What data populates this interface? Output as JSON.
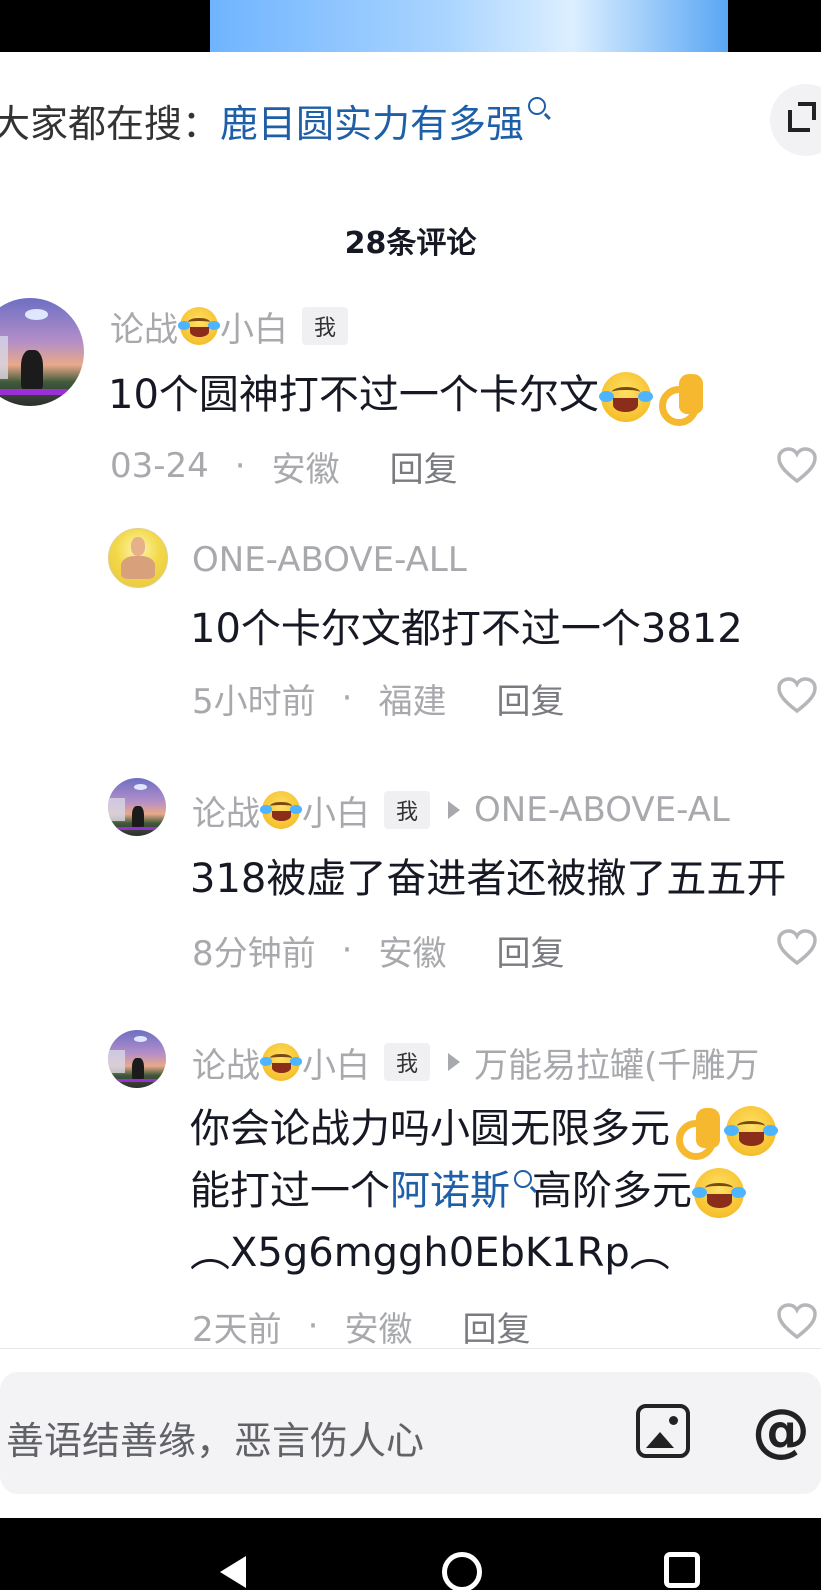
{
  "search": {
    "prefix": "大家都在搜：",
    "term": "鹿目圆实力有多强"
  },
  "header": {
    "comment_count": "28条评论"
  },
  "comments": [
    {
      "username": "论战",
      "username_suffix": "小白",
      "badge": "我",
      "text": "10个圆神打不过一个卡尔文",
      "date": "03-24",
      "location": "安徽",
      "reply_label": "回复"
    },
    {
      "username": "ONE-ABOVE-ALL",
      "text": "10个卡尔文都打不过一个3812",
      "date": "5小时前",
      "location": "福建",
      "reply_label": "回复"
    },
    {
      "username": "论战",
      "username_suffix": "小白",
      "badge": "我",
      "reply_to": "ONE-ABOVE-AL",
      "text": "318被虚了奋进者还被撤了五五开",
      "date": "8分钟前",
      "location": "安徽",
      "reply_label": "回复"
    },
    {
      "username": "论战",
      "username_suffix": "小白",
      "badge": "我",
      "reply_to": "万能易拉罐(千雕万",
      "text_line1": "你会论战力吗小圆无限多元",
      "text_line2_a": "能打过一个",
      "text_line2_link": "阿诺斯",
      "text_line2_b": "高阶多元",
      "text_line3": "︵X5g6mggh0EbK1Rp︵",
      "date": "2天前",
      "location": "安徽",
      "reply_label": "回复"
    }
  ],
  "meta_separator": "·",
  "input": {
    "placeholder": "善语结善缘，恶言伤人心",
    "at_symbol": "@"
  },
  "icons": {
    "search": "search-icon",
    "expand": "expand-icon",
    "like": "heart-icon",
    "image": "image-icon",
    "at": "at-icon"
  },
  "colors": {
    "link": "#1f5fa8",
    "secondary_text": "#a8a9ad",
    "primary_text": "#161823"
  }
}
